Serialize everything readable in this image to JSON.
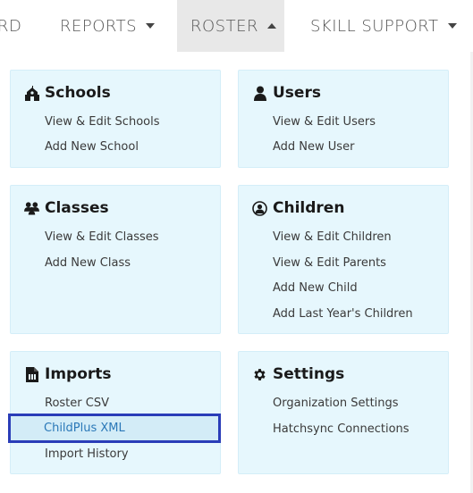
{
  "nav": {
    "partial_item": "RD",
    "reports": "REPORTS",
    "roster": "ROSTER",
    "skill_support": "SKILL SUPPORT"
  },
  "menu": {
    "schools": {
      "title": "Schools",
      "icon": "school-icon",
      "links": [
        "View & Edit Schools",
        "Add New School"
      ]
    },
    "users": {
      "title": "Users",
      "icon": "user-icon",
      "links": [
        "View & Edit Users",
        "Add New User"
      ]
    },
    "classes": {
      "title": "Classes",
      "icon": "group-icon",
      "links": [
        "View & Edit Classes",
        "Add New Class"
      ]
    },
    "children": {
      "title": "Children",
      "icon": "child-icon",
      "links": [
        "View & Edit Children",
        "View & Edit Parents",
        "Add New Child",
        "Add Last Year's Children"
      ]
    },
    "imports": {
      "title": "Imports",
      "icon": "file-icon",
      "links": [
        "Roster CSV",
        "ChildPlus XML",
        "Import History"
      ]
    },
    "settings": {
      "title": "Settings",
      "icon": "gear-icon",
      "links": [
        "Organization Settings",
        "Hatchsync Connections"
      ]
    }
  },
  "colors": {
    "card_bg": "#e6f7fd",
    "active_tab_bg": "#e8e8e8",
    "highlight_border": "#2a3db8",
    "active_link": "#2a78b8"
  }
}
